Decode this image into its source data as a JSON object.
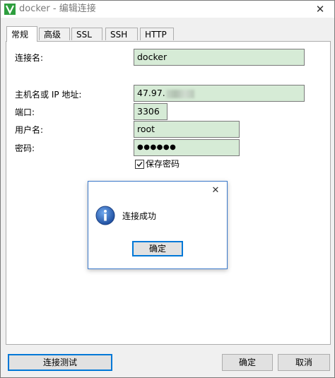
{
  "window": {
    "title": "docker - 编辑连接",
    "close_glyph": "✕"
  },
  "tabs": [
    {
      "label": "常规",
      "active": true
    },
    {
      "label": "高级",
      "active": false
    },
    {
      "label": "SSL",
      "active": false
    },
    {
      "label": "SSH",
      "active": false
    },
    {
      "label": "HTTP",
      "active": false
    }
  ],
  "form": {
    "connection_name_label": "连接名:",
    "connection_name_value": "docker",
    "host_label": "主机名或 IP 地址:",
    "host_value": "47.97.",
    "port_label": "端口:",
    "port_value": "3306",
    "username_label": "用户名:",
    "username_value": "root",
    "password_label": "密码:",
    "password_value": "●●●●●●",
    "save_password_label": "保存密码",
    "save_password_checked": true
  },
  "dialog": {
    "close_glyph": "✕",
    "message": "连接成功",
    "ok_label": "确定"
  },
  "buttons": {
    "test_connection": "连接测试",
    "ok": "确定",
    "cancel": "取消"
  },
  "colors": {
    "field_bg": "#d6ebd6",
    "accent": "#0078d7",
    "info_icon": "#1f5fb4"
  }
}
